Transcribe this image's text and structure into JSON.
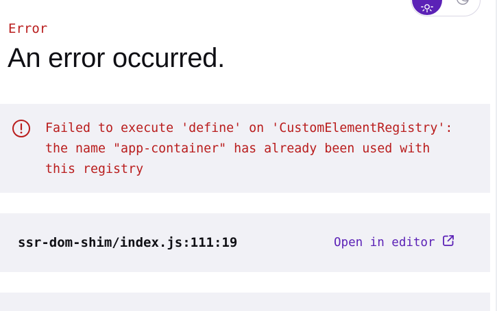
{
  "header": {
    "eyebrow": "Error",
    "title": "An error occurred."
  },
  "theme_toggle": {
    "active": "light",
    "light_icon": "sun-icon",
    "dark_icon": "moon-icon"
  },
  "error": {
    "icon": "alert-circle-icon",
    "message": "Failed to execute 'define' on 'CustomElementRegistry':\nthe name \"app-container\" has already been used with\nthis registry"
  },
  "stack_frame": {
    "file": "ssr-dom-shim/index.js:111:19",
    "open_label": "Open in editor",
    "open_icon": "external-link-icon"
  },
  "colors": {
    "error_red": "#b91c1c",
    "accent_purple": "#5b21b6",
    "panel_bg": "#f1f1f6",
    "text_dark": "#0f0f14"
  }
}
